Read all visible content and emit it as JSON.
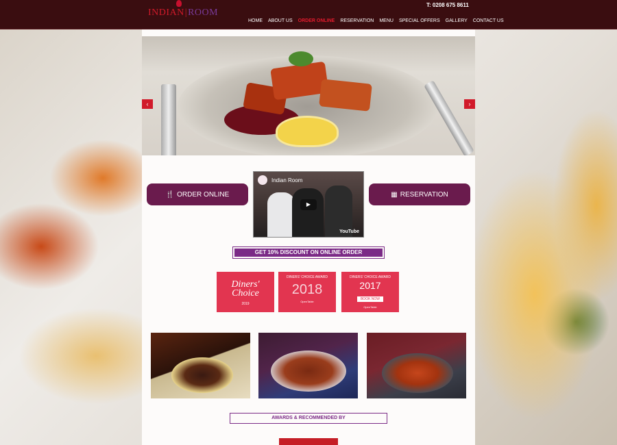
{
  "header": {
    "logo_text_main": "INDIAN",
    "logo_text_accent": "ROOM",
    "phone": "T: 0208 675 8611",
    "nav": [
      {
        "label": "HOME",
        "active": false
      },
      {
        "label": "ABOUT US",
        "active": false
      },
      {
        "label": "ORDER ONLINE",
        "active": true
      },
      {
        "label": "RESERVATION",
        "active": false
      },
      {
        "label": "MENU",
        "active": false
      },
      {
        "label": "SPECIAL OFFERS",
        "active": false
      },
      {
        "label": "GALLERY",
        "active": false
      },
      {
        "label": "CONTACT US",
        "active": false
      }
    ]
  },
  "slider": {
    "prev_glyph": "‹",
    "next_glyph": "›"
  },
  "cta": {
    "order_label": "ORDER ONLINE",
    "order_icon": "utensils-icon",
    "reservation_label": "RESERVATION",
    "reservation_icon": "calendar-icon"
  },
  "video": {
    "title": "Indian Room",
    "provider": "YouTube"
  },
  "discount": {
    "label": "GET 10% DISCOUNT ON ONLINE ORDER"
  },
  "awards": [
    {
      "title": "Diners' Choice",
      "year": "2019"
    },
    {
      "title": "DINERS' CHOICE AWARD",
      "year": "2018",
      "source": "OpenTable"
    },
    {
      "title": "DINERS' CHOICE AWARD",
      "year": "2017",
      "button": "BOOK NOW",
      "source": "OpenTable"
    }
  ],
  "section": {
    "awards_heading": "AWARDS & RECOMMENDED BY"
  },
  "colors": {
    "header_bg": "#3a0d10",
    "accent_red": "#d11a2a",
    "button_purple": "#6a1b4d",
    "discount_purple": "#7b2a86",
    "award_red": "#e23550"
  }
}
